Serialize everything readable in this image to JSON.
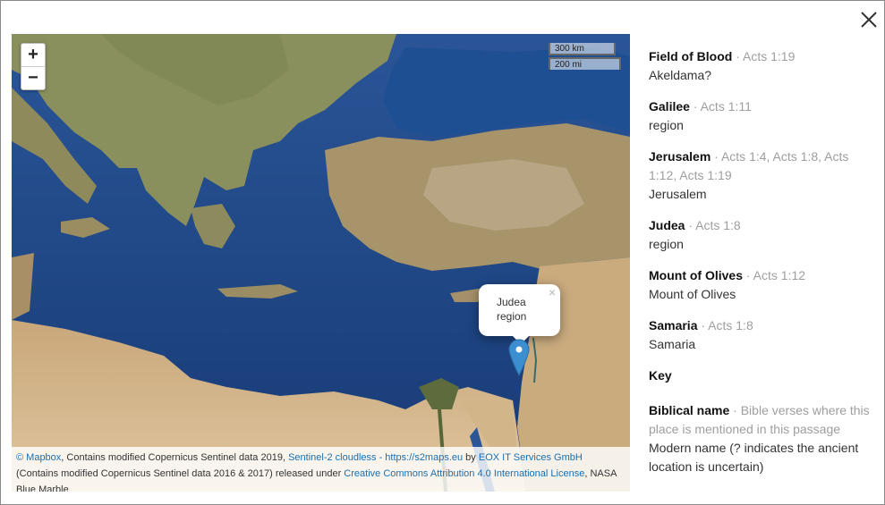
{
  "close_label": "close",
  "map": {
    "zoom_in": "+",
    "zoom_out": "−",
    "scale_km": "300 km",
    "scale_mi": "200 mi",
    "popup": {
      "title": "Judea",
      "subtitle": "region",
      "close": "×"
    },
    "attribution": {
      "mapbox": "© Mapbox",
      "t1": ", Contains modified Copernicus Sentinel data 2019, ",
      "s2": "Sentinel-2 cloudless - https://s2maps.eu",
      "t2": " by ",
      "eox": "EOX IT Services GmbH",
      "t3": " (Contains modified Copernicus Sentinel data 2016 & 2017) released under ",
      "cc": "Creative Commons Attribution 4.0 International License",
      "t4": ", NASA Blue Marble"
    }
  },
  "places": [
    {
      "name": "Field of Blood",
      "refs": "Acts 1:19",
      "modern": "Akeldama?"
    },
    {
      "name": "Galilee",
      "refs": "Acts 1:11",
      "modern": "region"
    },
    {
      "name": "Jerusalem",
      "refs": "Acts 1:4, Acts 1:8, Acts 1:12, Acts 1:19",
      "modern": "Jerusalem"
    },
    {
      "name": "Judea",
      "refs": "Acts 1:8",
      "modern": "region"
    },
    {
      "name": "Mount of Olives",
      "refs": "Acts 1:12",
      "modern": "Mount of Olives"
    },
    {
      "name": "Samaria",
      "refs": "Acts 1:8",
      "modern": "Samaria"
    }
  ],
  "key": {
    "heading": "Key",
    "name_label": "Biblical name",
    "verses_label": "Bible verses where this place is mentioned in this passage",
    "modern_label": "Modern name (? indicates the ancient location is uncertain)"
  },
  "separator": " · ",
  "colors": {
    "sea": "#1c3f7c",
    "land": "#b7a075",
    "link": "#1a6fb0",
    "marker": "#3b8ed0"
  }
}
